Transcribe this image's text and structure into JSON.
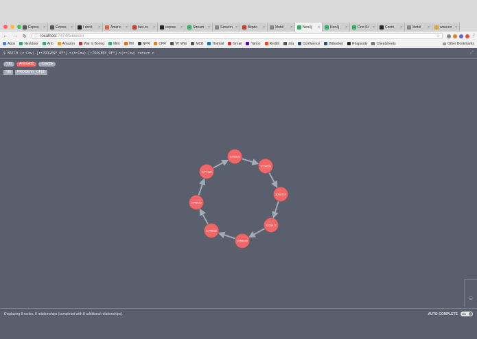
{
  "browser": {
    "tabs": [
      {
        "title": "Expres",
        "color": "#555555",
        "active": false
      },
      {
        "title": "Expres",
        "color": "#555555",
        "active": false
      },
      {
        "title": "I don't",
        "color": "#222222",
        "active": false
      },
      {
        "title": "Americ",
        "color": "#e0603a",
        "active": false
      },
      {
        "title": "fast-cs",
        "color": "#c0392b",
        "active": false
      },
      {
        "title": "expres",
        "color": "#222222",
        "active": false
      },
      {
        "title": "Stream",
        "color": "#27ae60",
        "active": false
      },
      {
        "title": "Session",
        "color": "#888888",
        "active": false
      },
      {
        "title": "Bkpdo",
        "color": "#c0392b",
        "active": false
      },
      {
        "title": "Mobil",
        "color": "#888888",
        "active": false
      },
      {
        "title": "Neo4j",
        "color": "#27ae60",
        "active": true
      },
      {
        "title": "Neo4j",
        "color": "#27ae60",
        "active": false
      },
      {
        "title": "First St",
        "color": "#27ae60",
        "active": false
      },
      {
        "title": "Contri",
        "color": "#222222",
        "active": false
      },
      {
        "title": "Mobil",
        "color": "#888888",
        "active": false
      },
      {
        "title": "www.co",
        "color": "#e0a030",
        "active": false
      }
    ],
    "close_glyph": "×",
    "url_host": "localhost",
    "url_rest": ":7474/browser/",
    "bookmarks": [
      {
        "label": "Apps",
        "color": "#4285f4"
      },
      {
        "label": "Nextdoor",
        "color": "#27ae60"
      },
      {
        "label": "Arlo",
        "color": "#27ae60"
      },
      {
        "label": "Amazon",
        "color": "#f39c12"
      },
      {
        "label": "War Is Boring",
        "color": "#c0392b"
      },
      {
        "label": "Mint",
        "color": "#27ae60"
      },
      {
        "label": "HN",
        "color": "#ff6600"
      },
      {
        "label": "NPR",
        "color": "#2c3e50"
      },
      {
        "label": "CPR",
        "color": "#e67e22"
      },
      {
        "label": "'W' Wiki",
        "color": "#555555"
      },
      {
        "label": "MCB",
        "color": "#555555"
      },
      {
        "label": "Hotmail",
        "color": "#0078d7"
      },
      {
        "label": "Gmail",
        "color": "#d93025"
      },
      {
        "label": "Yahoo",
        "color": "#6001d2"
      },
      {
        "label": "Reddit",
        "color": "#ff4500"
      },
      {
        "label": "Jira",
        "color": "#555555"
      },
      {
        "label": "Confluence",
        "color": "#205081"
      },
      {
        "label": "Bitbucket",
        "color": "#205081"
      },
      {
        "label": "Rhapsody",
        "color": "#222222"
      },
      {
        "label": "Cheatsheets",
        "color": "#777777"
      }
    ],
    "other_bookmarks": "Other Bookmarks"
  },
  "neo4j": {
    "query": "$ MATCH (c:Cow)-[r:PROGENY_OF*]->(b:Cow)-[:PROGENY_OF*]->(c:Cow) return c",
    "legend_labels": [
      "*(8)",
      "Animal(8)",
      "Cow(8)"
    ],
    "legend_rels": [
      "*(8)",
      "PROGENY_OF(8)"
    ],
    "node_color": "#f16667",
    "rel_color": "#a5abb6",
    "nodes": [
      {
        "label": "1055262"
      },
      {
        "label": "1054099"
      },
      {
        "label": "1053737"
      },
      {
        "label": "1051472"
      },
      {
        "label": "1050949"
      },
      {
        "label": "1048632"
      },
      {
        "label": "1048613"
      },
      {
        "label": "1057150"
      }
    ],
    "status": "Displaying 8 nodes, 8 relationships (completed with 8 additional relationships).",
    "autocomplete": "AUTO-COMPLETE",
    "toggle": "ON"
  }
}
